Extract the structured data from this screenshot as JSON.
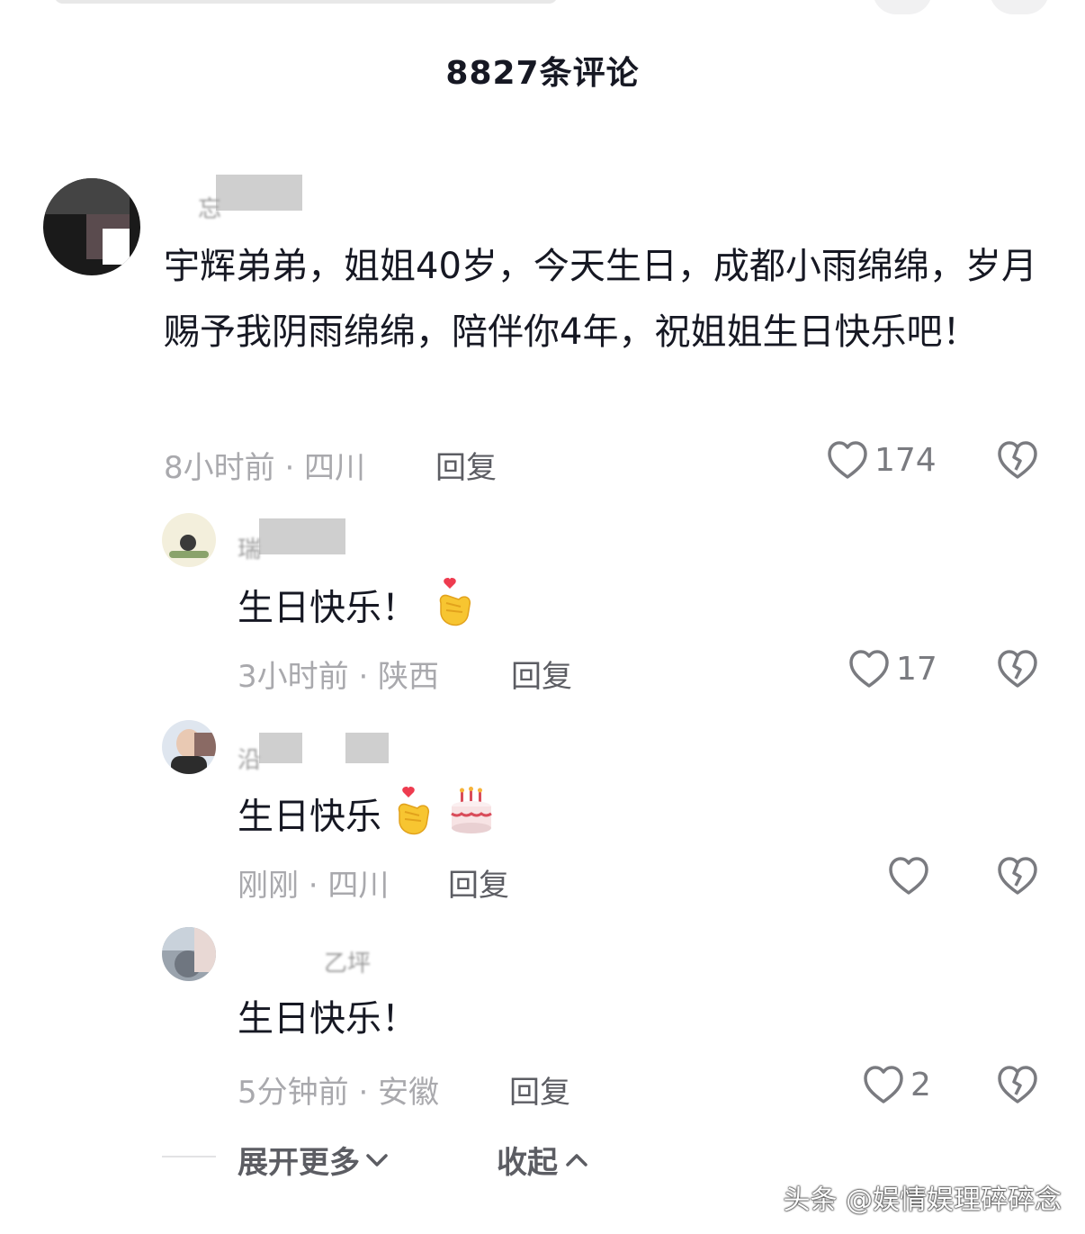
{
  "header": {
    "comment_count": "8827条评论"
  },
  "comments": [
    {
      "text": "宇辉弟弟，姐姐40岁，今天生日，成都小雨绵绵，岁月赐予我阴雨绵绵，陪伴你4年，祝姐姐生日快乐吧！",
      "meta": "8小时前 · 四川",
      "reply_label": "回复",
      "likes": "174"
    }
  ],
  "replies": [
    {
      "text": "生日快乐！",
      "meta": "3小时前 · 陕西",
      "reply_label": "回复",
      "likes": "17",
      "emoji": [
        "finger-heart"
      ]
    },
    {
      "text": "生日快乐",
      "meta": "刚刚 · 四川",
      "reply_label": "回复",
      "likes": "",
      "emoji": [
        "finger-heart",
        "birthday-cake"
      ]
    },
    {
      "text": "生日快乐！",
      "meta": "5分钟前 · 安徽",
      "reply_label": "回复",
      "likes": "2",
      "emoji": []
    }
  ],
  "footer": {
    "expand_more": "展开更多",
    "collapse": "收起"
  },
  "watermark": "头条 @娱情娱理碎碎念",
  "colors": {
    "text": "#161823",
    "meta": "#a9a9ad",
    "reply": "#5c5d63",
    "icon": "#7a7b80"
  }
}
